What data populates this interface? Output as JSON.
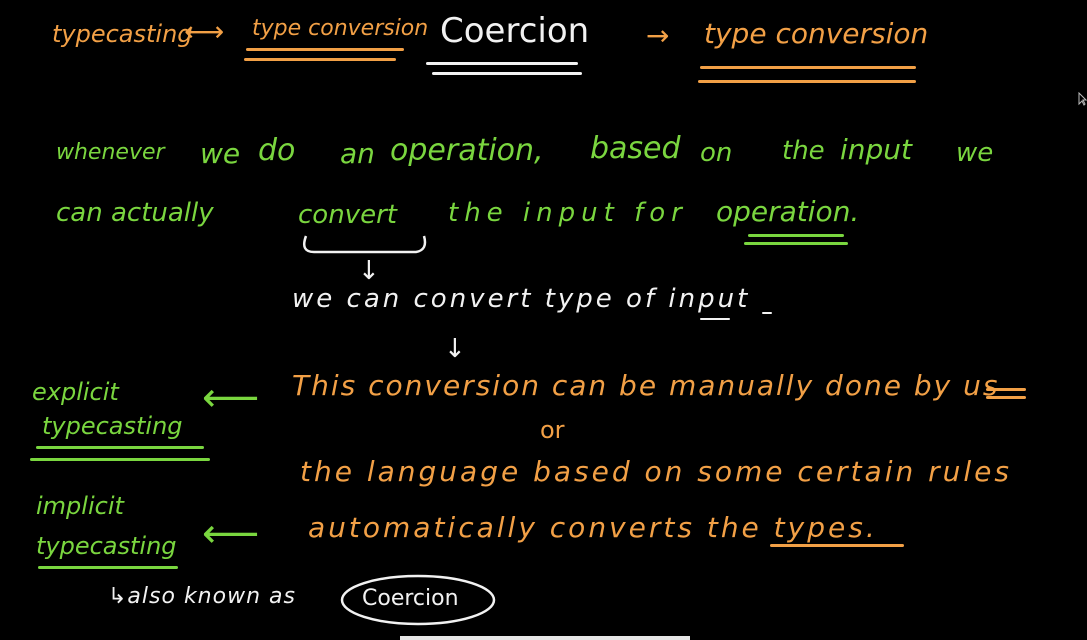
{
  "colors": {
    "background": "#000000",
    "orange": "#f2a046",
    "green": "#7ad63f",
    "white": "#f2f2f2"
  },
  "header": {
    "typecasting": "typecasting",
    "arrow_double": "⟷",
    "type_conversion_left": "type conversion",
    "coercion_title": "Coercion",
    "arrow_right": "→",
    "type_conversion_right": "type conversion"
  },
  "definition": {
    "line1": [
      "whenever",
      "we",
      "do",
      "an",
      "operation,",
      "based",
      "on",
      "the",
      "input",
      "we"
    ],
    "line2": {
      "prefix": "can actually",
      "convert": "convert",
      "middle": "the input for",
      "operation": "operation."
    }
  },
  "explanation": {
    "down_arrow": "↓",
    "we_can_convert": "we can convert type of input",
    "down_arrow_2": "↓",
    "this_conversion": "This conversion can be manually done by us",
    "or": "or",
    "language_rules": "the language based on some certain rules",
    "automatically": "automatically converts the types."
  },
  "side_labels": {
    "explicit_line1": "explicit",
    "explicit_line2": "typecasting",
    "left_arrow": "⟵",
    "implicit_line1": "implicit",
    "implicit_line2": "typecasting",
    "left_arrow_2": "⟵",
    "also_known_as": "↳also known as",
    "coercion_circled": "Coercion"
  }
}
